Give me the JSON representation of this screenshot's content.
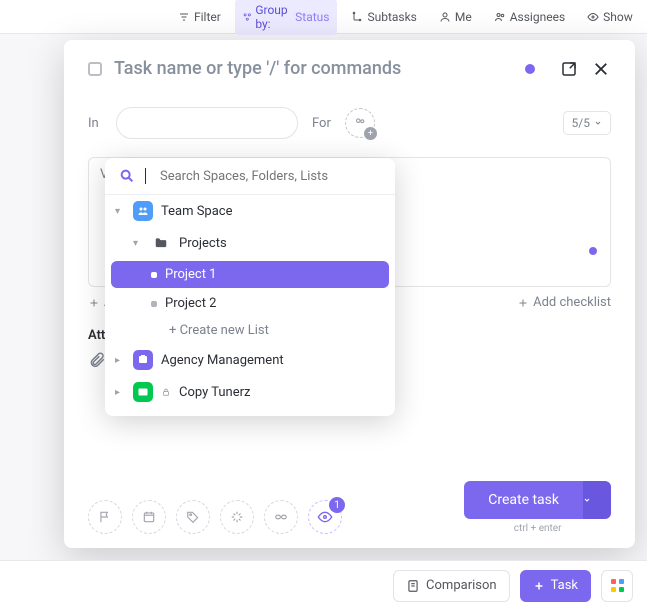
{
  "toolbar": {
    "filter": "Filter",
    "group_by_label": "Group by:",
    "group_by_value": "Status",
    "subtasks": "Subtasks",
    "me": "Me",
    "assignees": "Assignees",
    "show": "Show"
  },
  "modal": {
    "title_placeholder": "Task name or type '/' for commands",
    "in_label": "In",
    "for_label": "For",
    "counter": "5/5",
    "add_action": "A",
    "add_checklist": "Add checklist",
    "attachments_label": "Atta",
    "desc_hidden_letter": "V"
  },
  "dropdown": {
    "search_placeholder": "Search Spaces, Folders, Lists",
    "items": [
      {
        "label": "Team Space"
      },
      {
        "label": "Projects"
      },
      {
        "label": "Project 1"
      },
      {
        "label": "Project 2"
      },
      {
        "label": "+ Create new List"
      },
      {
        "label": "Agency Management"
      },
      {
        "label": "Copy Tunerz"
      }
    ]
  },
  "footer": {
    "watch_count": "1",
    "create_label": "Create task",
    "hint": "ctrl + enter"
  },
  "bottombar": {
    "comparison": "Comparison",
    "task": "Task"
  }
}
